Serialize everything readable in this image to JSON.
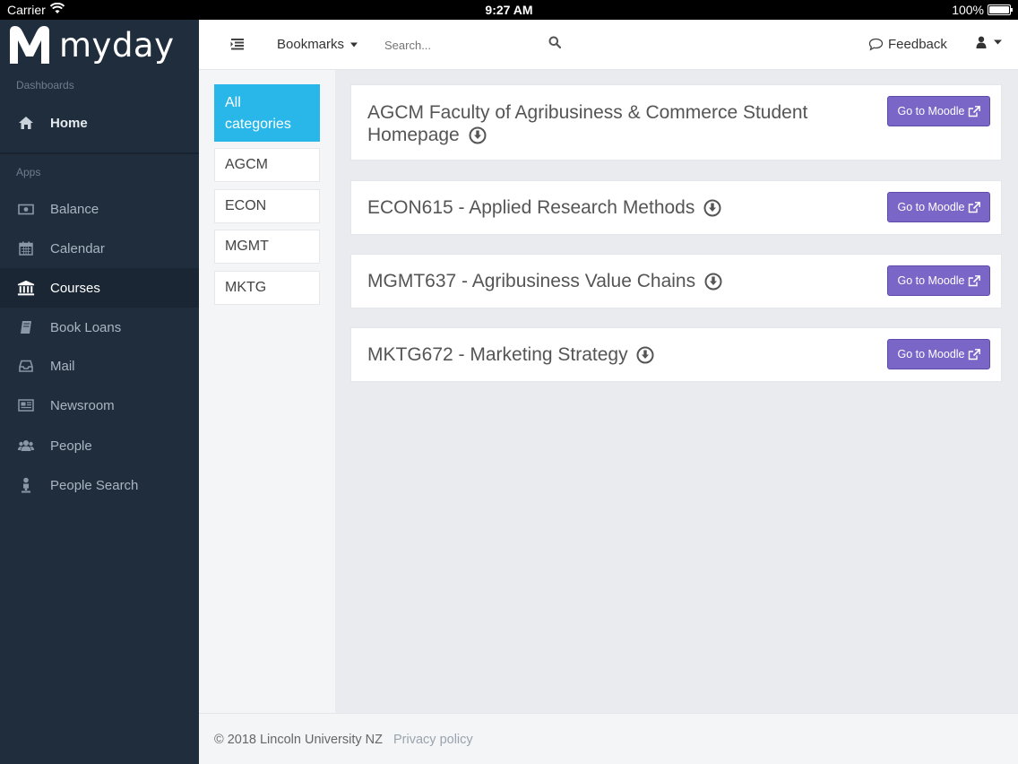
{
  "status_bar": {
    "carrier": "Carrier",
    "time": "9:27 AM",
    "battery": "100%"
  },
  "sidebar": {
    "logo_text": "myday",
    "dashboards_label": "Dashboards",
    "apps_label": "Apps",
    "items": [
      {
        "label": "Home",
        "icon": "home-icon"
      },
      {
        "label": "Balance",
        "icon": "money-icon"
      },
      {
        "label": "Calendar",
        "icon": "calendar-icon"
      },
      {
        "label": "Courses",
        "icon": "institution-icon"
      },
      {
        "label": "Book Loans",
        "icon": "book-icon"
      },
      {
        "label": "Mail",
        "icon": "inbox-icon"
      },
      {
        "label": "Newsroom",
        "icon": "newspaper-icon"
      },
      {
        "label": "People",
        "icon": "users-icon"
      },
      {
        "label": "People Search",
        "icon": "person-search-icon"
      }
    ],
    "active_item": "Courses"
  },
  "topbar": {
    "bookmarks_label": "Bookmarks",
    "search_placeholder": "Search...",
    "feedback_label": "Feedback"
  },
  "categories": [
    "All categories",
    "AGCM",
    "ECON",
    "MGMT",
    "MKTG"
  ],
  "courses": [
    {
      "title": "AGCM Faculty of Agribusiness & Commerce Student Homepage",
      "button": "Go to Moodle"
    },
    {
      "title": "ECON615 - Applied Research Methods",
      "button": "Go to Moodle"
    },
    {
      "title": "MGMT637 - Agribusiness Value Chains",
      "button": "Go to Moodle"
    },
    {
      "title": "MKTG672 - Marketing Strategy",
      "button": "Go to Moodle"
    }
  ],
  "footer": {
    "copyright": "© 2018 Lincoln University NZ",
    "privacy": "Privacy policy"
  },
  "colors": {
    "sidebar": "#1f2d3d",
    "category_active": "#29b6e8",
    "moodle_button": "#7a66c7",
    "content_bg": "#e9ebee"
  }
}
